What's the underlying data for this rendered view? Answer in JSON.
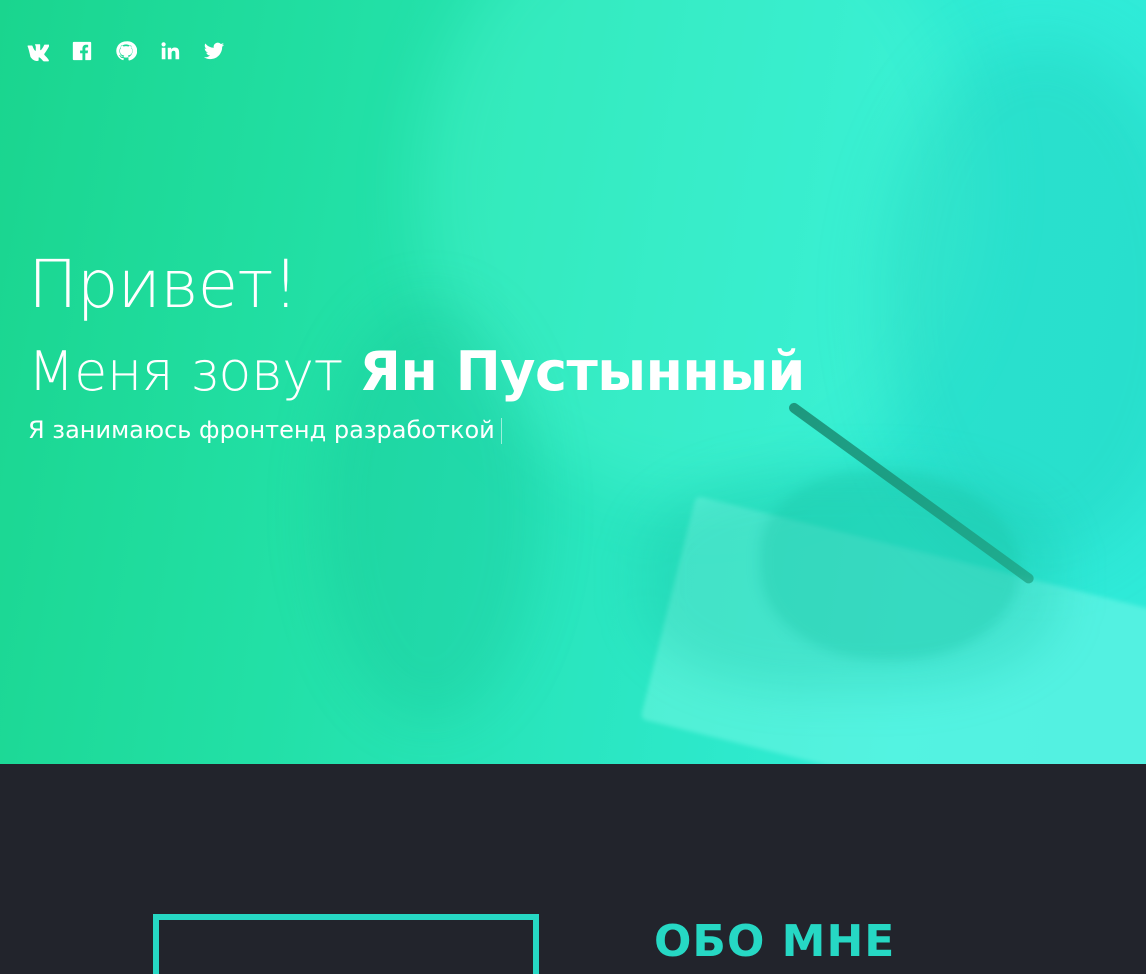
{
  "social": [
    {
      "icon": "vk-icon",
      "label": "VK"
    },
    {
      "icon": "facebook-icon",
      "label": "Facebook"
    },
    {
      "icon": "github-icon",
      "label": "GitHub"
    },
    {
      "icon": "linkedin-icon",
      "label": "LinkedIn"
    },
    {
      "icon": "twitter-icon",
      "label": "Twitter"
    }
  ],
  "hero": {
    "greeting": "Привет!",
    "name_prefix": "Меня зовут ",
    "name": "Ян Пустынный",
    "role": "Я занимаюсь фронтенд разработкой"
  },
  "about": {
    "title": "ОБО МНЕ"
  },
  "colors": {
    "accent": "#26d8c4",
    "hero_gradient_start": "#1ad58e",
    "hero_gradient_end": "#30ecd8",
    "dark_background": "#22242c"
  }
}
